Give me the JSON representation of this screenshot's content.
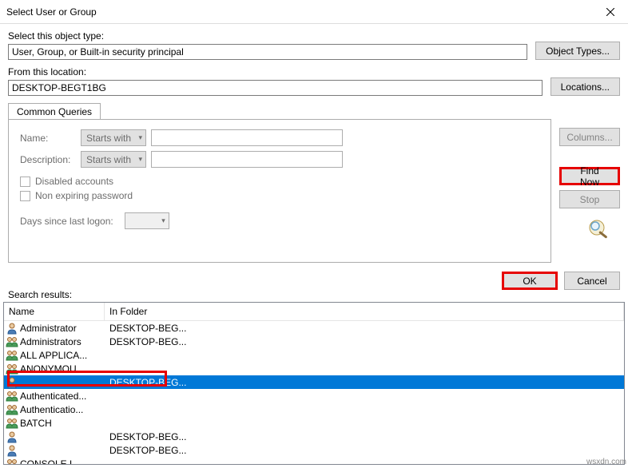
{
  "title": "Select User or Group",
  "objectType": {
    "label": "Select this object type:",
    "value": "User, Group, or Built-in security principal",
    "button": "Object Types..."
  },
  "location": {
    "label": "From this location:",
    "value": "DESKTOP-BEGT1BG",
    "button": "Locations..."
  },
  "tab": "Common Queries",
  "query": {
    "nameLabel": "Name:",
    "nameMode": "Starts with",
    "descLabel": "Description:",
    "descMode": "Starts with",
    "disabled": "Disabled accounts",
    "nonExpiring": "Non expiring password",
    "logonLabel": "Days since last logon:"
  },
  "buttons": {
    "columns": "Columns...",
    "findNow": "Find Now",
    "stop": "Stop",
    "ok": "OK",
    "cancel": "Cancel"
  },
  "resultsLabel": "Search results:",
  "columns": {
    "name": "Name",
    "folder": "In Folder"
  },
  "results": [
    {
      "type": "user",
      "name": "Administrator",
      "folder": "DESKTOP-BEG..."
    },
    {
      "type": "group",
      "name": "Administrators",
      "folder": "DESKTOP-BEG..."
    },
    {
      "type": "group",
      "name": "ALL APPLICA...",
      "folder": ""
    },
    {
      "type": "group",
      "name": "ANONYMOU...",
      "folder": ""
    },
    {
      "type": "user",
      "name": "...",
      "folder": "DESKTOP-BEG...",
      "selected": true
    },
    {
      "type": "group",
      "name": "Authenticated...",
      "folder": ""
    },
    {
      "type": "group",
      "name": "Authenticatio...",
      "folder": ""
    },
    {
      "type": "group",
      "name": "BATCH",
      "folder": ""
    },
    {
      "type": "user",
      "name": "",
      "folder": "DESKTOP-BEG..."
    },
    {
      "type": "user",
      "name": "",
      "folder": "DESKTOP-BEG..."
    },
    {
      "type": "group",
      "name": "CONSOLE L...",
      "folder": ""
    }
  ],
  "watermark": "wsxdn.com"
}
